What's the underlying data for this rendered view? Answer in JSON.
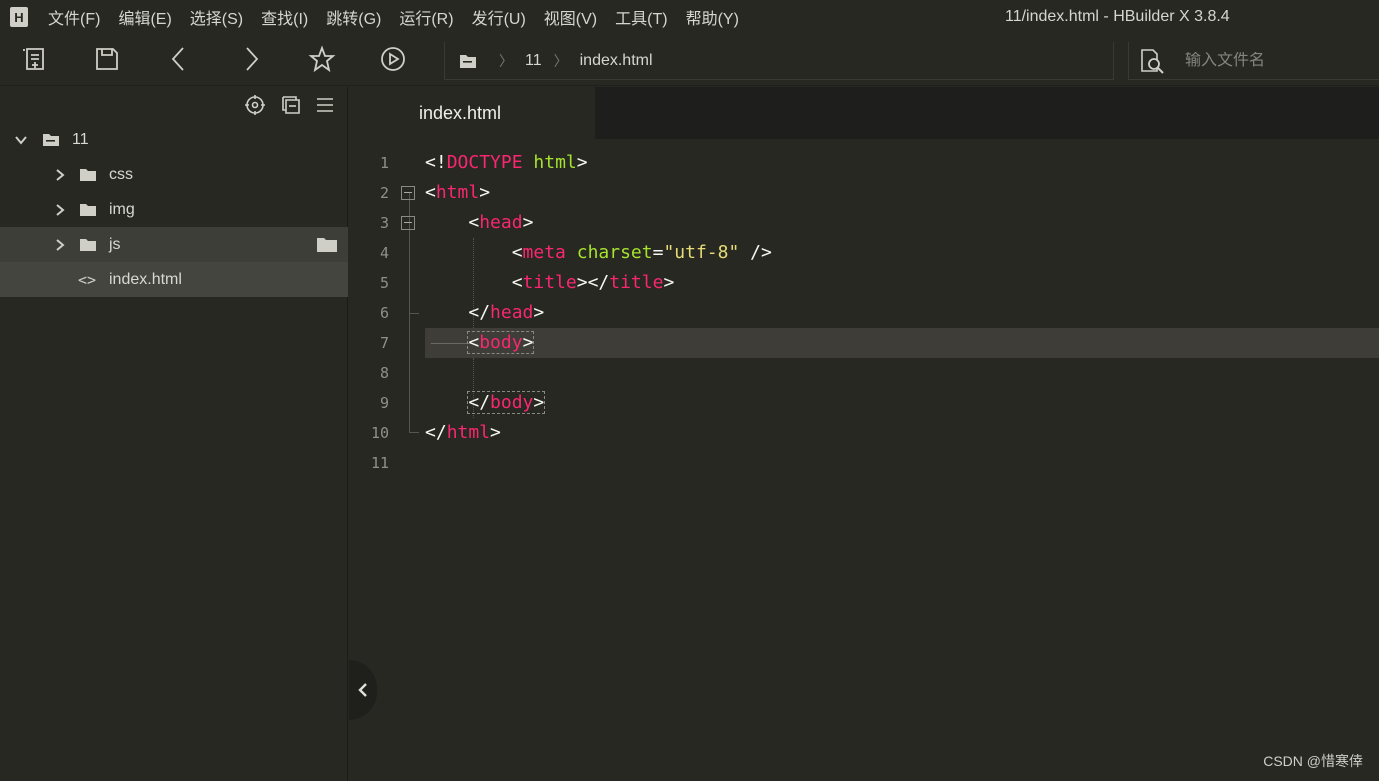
{
  "menubar": {
    "items": [
      "文件(F)",
      "编辑(E)",
      "选择(S)",
      "查找(I)",
      "跳转(G)",
      "运行(R)",
      "发行(U)",
      "视图(V)",
      "工具(T)",
      "帮助(Y)"
    ],
    "window_title": "11/index.html - HBuilder X 3.8.4"
  },
  "toolbar": {
    "buttons": [
      "new-file",
      "save",
      "back",
      "forward",
      "favorite",
      "run"
    ],
    "breadcrumb": {
      "root": "11",
      "file": "index.html"
    },
    "search_placeholder": "输入文件名"
  },
  "sidebar": {
    "tree": [
      {
        "label": "11",
        "type": "project",
        "expanded": true
      },
      {
        "label": "css",
        "type": "folder",
        "expanded": false
      },
      {
        "label": "img",
        "type": "folder",
        "expanded": false
      },
      {
        "label": "js",
        "type": "folder",
        "expanded": false
      },
      {
        "label": "index.html",
        "type": "file"
      }
    ]
  },
  "editor": {
    "tab_label": "index.html",
    "line_numbers": [
      "1",
      "2",
      "3",
      "4",
      "5",
      "6",
      "7",
      "8",
      "9",
      "10",
      "11"
    ],
    "current_line": 7
  },
  "watermark": "CSDN @惜寒倖",
  "colors": {
    "tag": "#f92672",
    "attr": "#a6e22e",
    "string": "#e6db74",
    "background": "#272822"
  }
}
